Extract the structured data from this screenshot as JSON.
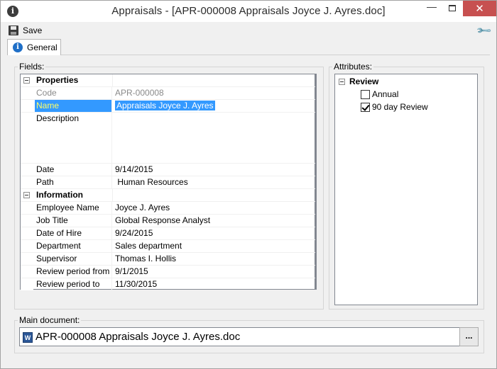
{
  "window": {
    "title": "Appraisals - [APR-000008 Appraisals Joyce J. Ayres.doc]",
    "close_glyph": "✕",
    "minimize_glyph": "—",
    "icon": "info-icon"
  },
  "toolbar": {
    "save_label": "Save",
    "settings_icon": "wrench-icon"
  },
  "tabs": [
    {
      "label": "General",
      "icon": "info-icon",
      "active": true
    }
  ],
  "fields": {
    "title": "Fields:",
    "categories": [
      {
        "label": "Properties",
        "rows": [
          {
            "name": "Code",
            "value": "APR-000008",
            "readonly": true
          },
          {
            "name": "Name",
            "value": "Appraisals Joyce J. Ayres",
            "selected": true
          },
          {
            "name": "Description",
            "value": ""
          },
          {
            "name": "Date",
            "value": "9/14/2015"
          },
          {
            "name": "Path",
            "value": " Human Resources"
          }
        ]
      },
      {
        "label": "Information",
        "rows": [
          {
            "name": "Employee Name",
            "value": "Joyce J. Ayres"
          },
          {
            "name": "Job Title",
            "value": "Global Response Analyst"
          },
          {
            "name": "Date of Hire",
            "value": "9/24/2015"
          },
          {
            "name": "Department",
            "value": "Sales department"
          },
          {
            "name": "Supervisor",
            "value": "Thomas I. Hollis"
          },
          {
            "name": "Review period from",
            "value": "9/1/2015"
          },
          {
            "name": "Review period to",
            "value": "11/30/2015"
          }
        ]
      }
    ]
  },
  "attributes": {
    "title": "Attributes:",
    "root_label": "Review",
    "items": [
      {
        "label": "Annual",
        "checked": false
      },
      {
        "label": "90 day Review",
        "checked": true
      }
    ]
  },
  "main_document": {
    "title": "Main document:",
    "file_name": "APR-000008 Appraisals Joyce J. Ayres.doc",
    "file_icon": "word-doc-icon",
    "browse_label": "...",
    "word_icon_letter": "W"
  },
  "colors": {
    "selection": "#3399ff",
    "selected_name_text": "#ffff66",
    "close_button": "#c75050",
    "readonly_text": "#8a8a8a"
  }
}
